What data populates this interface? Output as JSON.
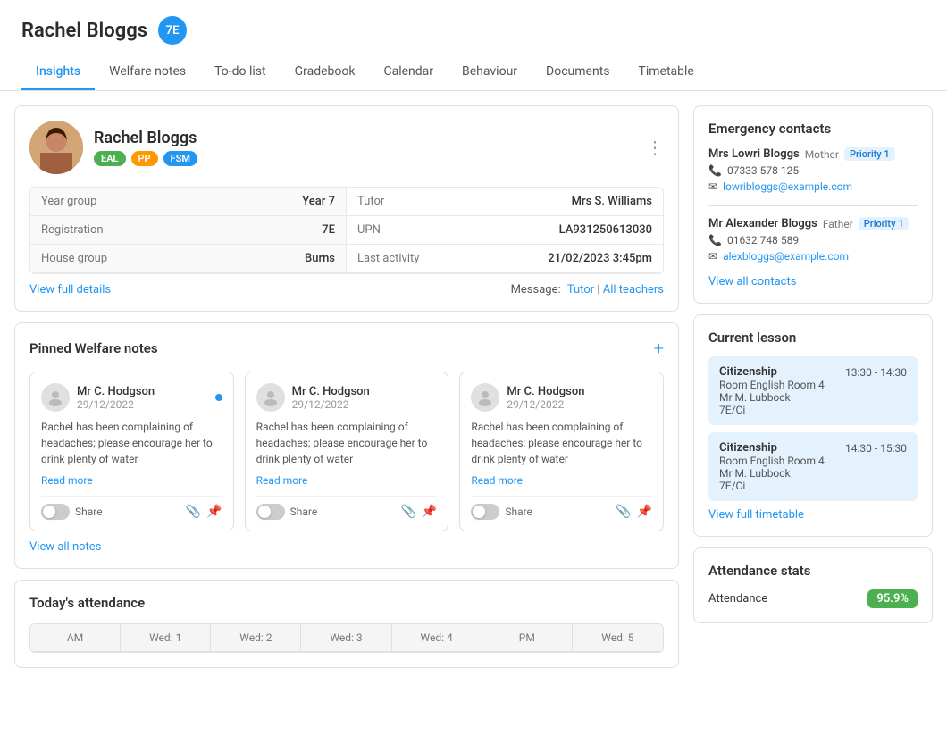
{
  "header": {
    "student_name": "Rachel Bloggs",
    "year_badge": "7E"
  },
  "nav": {
    "tabs": [
      {
        "label": "Insights",
        "active": true
      },
      {
        "label": "Welfare notes",
        "active": false
      },
      {
        "label": "To-do list",
        "active": false
      },
      {
        "label": "Gradebook",
        "active": false
      },
      {
        "label": "Calendar",
        "active": false
      },
      {
        "label": "Behaviour",
        "active": false
      },
      {
        "label": "Documents",
        "active": false
      },
      {
        "label": "Timetable",
        "active": false
      }
    ]
  },
  "student": {
    "name": "Rachel Bloggs",
    "badges": [
      "EAL",
      "PP",
      "FSM"
    ],
    "year_group_label": "Year group",
    "year_group_value": "Year 7",
    "tutor_label": "Tutor",
    "tutor_value": "Mrs S. Williams",
    "registration_label": "Registration",
    "registration_value": "7E",
    "upn_label": "UPN",
    "upn_value": "LA931250613030",
    "house_group_label": "House group",
    "house_group_value": "Burns",
    "last_activity_label": "Last activity",
    "last_activity_value": "21/02/2023 3:45pm",
    "view_full_details": "View full details",
    "message_label": "Message:",
    "message_tutor": "Tutor",
    "message_teachers": "All teachers"
  },
  "welfare_notes": {
    "title": "Pinned Welfare notes",
    "view_all": "View all notes",
    "notes": [
      {
        "author": "Mr C. Hodgson",
        "date": "29/12/2022",
        "body": "Rachel has been complaining of headaches; please encourage her to drink plenty of water",
        "read_more": "Read more",
        "share_label": "Share",
        "has_dot": true
      },
      {
        "author": "Mr C. Hodgson",
        "date": "29/12/2022",
        "body": "Rachel has been complaining of headaches; please encourage her to drink plenty of water",
        "read_more": "Read more",
        "share_label": "Share",
        "has_dot": false
      },
      {
        "author": "Mr C. Hodgson",
        "date": "29/12/2022",
        "body": "Rachel has been complaining of headaches; please encourage her to drink plenty of water",
        "read_more": "Read more",
        "share_label": "Share",
        "has_dot": false
      }
    ]
  },
  "attendance": {
    "title": "Today's attendance",
    "headers": [
      "AM",
      "Wed: 1",
      "Wed: 2",
      "Wed: 3",
      "Wed: 4",
      "PM",
      "Wed: 5"
    ]
  },
  "emergency_contacts": {
    "title": "Emergency contacts",
    "contacts": [
      {
        "name": "Mrs Lowri Bloggs",
        "role": "Mother",
        "priority": "Priority 1",
        "phone": "07333 578 125",
        "email": "lowribloggs@example.com"
      },
      {
        "name": "Mr Alexander Bloggs",
        "role": "Father",
        "priority": "Priority 1",
        "phone": "01632 748 589",
        "email": "alexbloggs@example.com"
      }
    ],
    "view_all": "View all contacts"
  },
  "current_lesson": {
    "title": "Current lesson",
    "lessons": [
      {
        "subject": "Citizenship",
        "time": "13:30 - 14:30",
        "room": "Room English Room 4",
        "teacher": "Mr M. Lubbock",
        "class": "7E/Ci"
      },
      {
        "subject": "Citizenship",
        "time": "14:30 - 15:30",
        "room": "Room English Room 4",
        "teacher": "Mr M. Lubbock",
        "class": "7E/Ci"
      }
    ],
    "view_timetable": "View full timetable"
  },
  "attendance_stats": {
    "title": "Attendance stats",
    "label": "Attendance",
    "value": "95.9%"
  }
}
